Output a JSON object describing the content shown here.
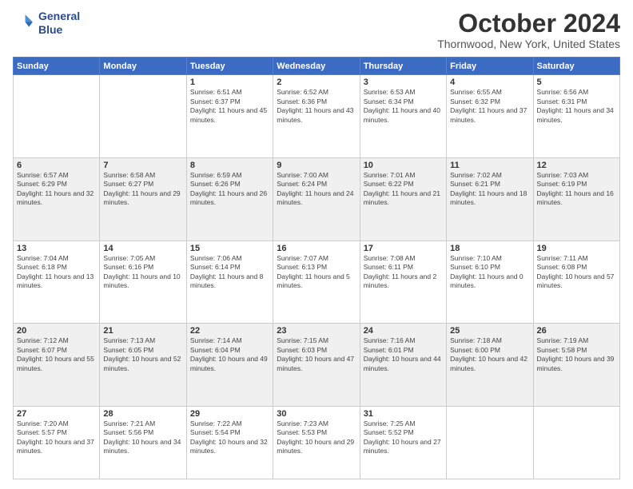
{
  "logo": {
    "line1": "General",
    "line2": "Blue"
  },
  "header": {
    "month": "October 2024",
    "location": "Thornwood, New York, United States"
  },
  "weekdays": [
    "Sunday",
    "Monday",
    "Tuesday",
    "Wednesday",
    "Thursday",
    "Friday",
    "Saturday"
  ],
  "weeks": [
    [
      {
        "day": "",
        "empty": true
      },
      {
        "day": "",
        "empty": true
      },
      {
        "day": "1",
        "sunrise": "6:51 AM",
        "sunset": "6:37 PM",
        "daylight": "11 hours and 45 minutes."
      },
      {
        "day": "2",
        "sunrise": "6:52 AM",
        "sunset": "6:36 PM",
        "daylight": "11 hours and 43 minutes."
      },
      {
        "day": "3",
        "sunrise": "6:53 AM",
        "sunset": "6:34 PM",
        "daylight": "11 hours and 40 minutes."
      },
      {
        "day": "4",
        "sunrise": "6:55 AM",
        "sunset": "6:32 PM",
        "daylight": "11 hours and 37 minutes."
      },
      {
        "day": "5",
        "sunrise": "6:56 AM",
        "sunset": "6:31 PM",
        "daylight": "11 hours and 34 minutes."
      }
    ],
    [
      {
        "day": "6",
        "sunrise": "6:57 AM",
        "sunset": "6:29 PM",
        "daylight": "11 hours and 32 minutes."
      },
      {
        "day": "7",
        "sunrise": "6:58 AM",
        "sunset": "6:27 PM",
        "daylight": "11 hours and 29 minutes."
      },
      {
        "day": "8",
        "sunrise": "6:59 AM",
        "sunset": "6:26 PM",
        "daylight": "11 hours and 26 minutes."
      },
      {
        "day": "9",
        "sunrise": "7:00 AM",
        "sunset": "6:24 PM",
        "daylight": "11 hours and 24 minutes."
      },
      {
        "day": "10",
        "sunrise": "7:01 AM",
        "sunset": "6:22 PM",
        "daylight": "11 hours and 21 minutes."
      },
      {
        "day": "11",
        "sunrise": "7:02 AM",
        "sunset": "6:21 PM",
        "daylight": "11 hours and 18 minutes."
      },
      {
        "day": "12",
        "sunrise": "7:03 AM",
        "sunset": "6:19 PM",
        "daylight": "11 hours and 16 minutes."
      }
    ],
    [
      {
        "day": "13",
        "sunrise": "7:04 AM",
        "sunset": "6:18 PM",
        "daylight": "11 hours and 13 minutes."
      },
      {
        "day": "14",
        "sunrise": "7:05 AM",
        "sunset": "6:16 PM",
        "daylight": "11 hours and 10 minutes."
      },
      {
        "day": "15",
        "sunrise": "7:06 AM",
        "sunset": "6:14 PM",
        "daylight": "11 hours and 8 minutes."
      },
      {
        "day": "16",
        "sunrise": "7:07 AM",
        "sunset": "6:13 PM",
        "daylight": "11 hours and 5 minutes."
      },
      {
        "day": "17",
        "sunrise": "7:08 AM",
        "sunset": "6:11 PM",
        "daylight": "11 hours and 2 minutes."
      },
      {
        "day": "18",
        "sunrise": "7:10 AM",
        "sunset": "6:10 PM",
        "daylight": "11 hours and 0 minutes."
      },
      {
        "day": "19",
        "sunrise": "7:11 AM",
        "sunset": "6:08 PM",
        "daylight": "10 hours and 57 minutes."
      }
    ],
    [
      {
        "day": "20",
        "sunrise": "7:12 AM",
        "sunset": "6:07 PM",
        "daylight": "10 hours and 55 minutes."
      },
      {
        "day": "21",
        "sunrise": "7:13 AM",
        "sunset": "6:05 PM",
        "daylight": "10 hours and 52 minutes."
      },
      {
        "day": "22",
        "sunrise": "7:14 AM",
        "sunset": "6:04 PM",
        "daylight": "10 hours and 49 minutes."
      },
      {
        "day": "23",
        "sunrise": "7:15 AM",
        "sunset": "6:03 PM",
        "daylight": "10 hours and 47 minutes."
      },
      {
        "day": "24",
        "sunrise": "7:16 AM",
        "sunset": "6:01 PM",
        "daylight": "10 hours and 44 minutes."
      },
      {
        "day": "25",
        "sunrise": "7:18 AM",
        "sunset": "6:00 PM",
        "daylight": "10 hours and 42 minutes."
      },
      {
        "day": "26",
        "sunrise": "7:19 AM",
        "sunset": "5:58 PM",
        "daylight": "10 hours and 39 minutes."
      }
    ],
    [
      {
        "day": "27",
        "sunrise": "7:20 AM",
        "sunset": "5:57 PM",
        "daylight": "10 hours and 37 minutes."
      },
      {
        "day": "28",
        "sunrise": "7:21 AM",
        "sunset": "5:56 PM",
        "daylight": "10 hours and 34 minutes."
      },
      {
        "day": "29",
        "sunrise": "7:22 AM",
        "sunset": "5:54 PM",
        "daylight": "10 hours and 32 minutes."
      },
      {
        "day": "30",
        "sunrise": "7:23 AM",
        "sunset": "5:53 PM",
        "daylight": "10 hours and 29 minutes."
      },
      {
        "day": "31",
        "sunrise": "7:25 AM",
        "sunset": "5:52 PM",
        "daylight": "10 hours and 27 minutes."
      },
      {
        "day": "",
        "empty": true
      },
      {
        "day": "",
        "empty": true
      }
    ]
  ]
}
